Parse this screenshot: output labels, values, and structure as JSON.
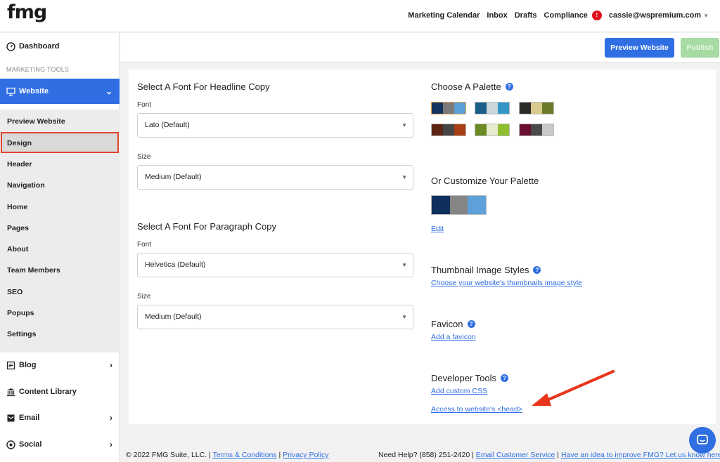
{
  "app": {
    "logo": "fmg"
  },
  "topnav": {
    "items": [
      "Marketing Calendar",
      "Inbox",
      "Drafts",
      "Compliance"
    ],
    "badge": "!",
    "user": "cassie@wspremium.com"
  },
  "sidebar": {
    "dashboard": "Dashboard",
    "section_label": "MARKETING TOOLS",
    "website": "Website",
    "sub_items": [
      "Preview Website",
      "Design",
      "Header",
      "Navigation",
      "Home",
      "Pages",
      "About",
      "Team Members",
      "SEO",
      "Popups",
      "Settings"
    ],
    "blog": "Blog",
    "content_library": "Content Library",
    "email": "Email",
    "social": "Social"
  },
  "actions": {
    "preview": "Preview Website",
    "publish": "Publish"
  },
  "headline": {
    "title": "Select A Font For Headline Copy",
    "font_label": "Font",
    "font_value": "Lato (Default)",
    "size_label": "Size",
    "size_value": "Medium (Default)"
  },
  "paragraph": {
    "title": "Select A Font For Paragraph Copy",
    "font_label": "Font",
    "font_value": "Helvetica (Default)",
    "size_label": "Size",
    "size_value": "Medium (Default)"
  },
  "palette": {
    "title": "Choose A Palette",
    "options": [
      [
        "#14335e",
        "#7a7a7a",
        "#5aa0d8"
      ],
      [
        "#1a5f8a",
        "#c9d6dc",
        "#3596c8"
      ],
      [
        "#2a2a26",
        "#d8c98c",
        "#6e7a2a"
      ],
      [
        "#5c2412",
        "#454545",
        "#a83e14"
      ],
      [
        "#6b8a22",
        "#e8eccf",
        "#8fbe30"
      ],
      [
        "#6b0f32",
        "#4a4a4a",
        "#c9c9c9"
      ]
    ],
    "custom_title": "Or Customize Your Palette",
    "custom_colors": [
      "#0f2f5c",
      "#858585",
      "#5ea0d9"
    ],
    "edit": "Edit"
  },
  "thumbnail": {
    "title": "Thumbnail Image Styles",
    "link": "Choose your website's thumbnails image style"
  },
  "favicon": {
    "title": "Favicon",
    "link": "Add a favicon"
  },
  "developer": {
    "title": "Developer Tools",
    "css_link": "Add custom CSS",
    "head_link": "Access to website's <head>"
  },
  "footer": {
    "copyright": "© 2022 FMG Suite, LLC. |",
    "terms": "Terms & Conditions",
    "sep": "|",
    "privacy": "Privacy Policy",
    "help": "Need Help? (858) 251-2420 |",
    "support": "Email Customer Service",
    "sep2": "|",
    "idea": "Have an idea to improve FMG? Let us know here."
  },
  "colors": {
    "primary": "#2f6ee3",
    "publish": "#a6dba1",
    "highlight": "#e2442a"
  }
}
